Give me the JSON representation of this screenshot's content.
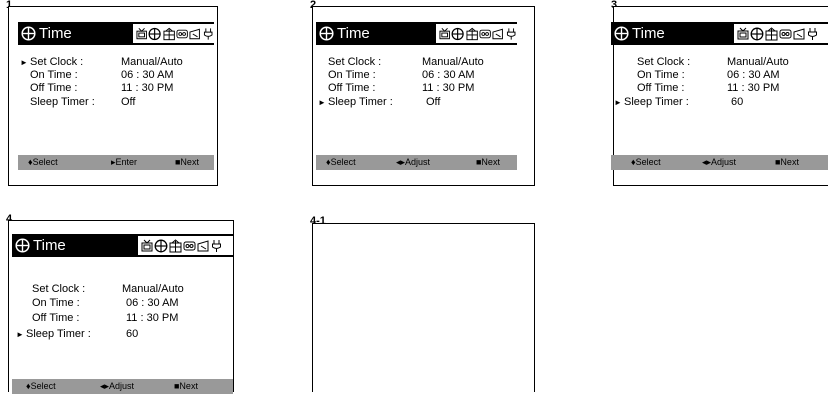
{
  "screens": [
    {
      "number": "1",
      "title": "Time",
      "labels": {
        "set_clock": "Set Clock :",
        "on_time": "On Time :",
        "off_time": "Off Time :",
        "sleep_timer": "Sleep Timer :"
      },
      "values": {
        "set_clock": "Manual/Auto",
        "on_time": "06 : 30  AM",
        "off_time": "11 : 30  PM",
        "sleep_timer": "Off"
      },
      "selected_row": "set_clock",
      "footer": {
        "left": "♦Select",
        "middle": "▸Enter",
        "right": "■Next"
      }
    },
    {
      "number": "2",
      "title": "Time",
      "labels": {
        "set_clock": "Set Clock :",
        "on_time": "On Time :",
        "off_time": "Off Time :",
        "sleep_timer": "Sleep Timer :"
      },
      "values": {
        "set_clock": "Manual/Auto",
        "on_time": "06 : 30  AM",
        "off_time": "11 : 30  PM",
        "sleep_timer": "Off"
      },
      "selected_row": "sleep_timer",
      "footer": {
        "left": "♦Select",
        "middle": "◂▸Adjust",
        "right": "■Next"
      }
    },
    {
      "number": "3",
      "title": "Time",
      "labels": {
        "set_clock": "Set Clock :",
        "on_time": "On Time :",
        "off_time": "Off Time :",
        "sleep_timer": "Sleep Timer :"
      },
      "values": {
        "set_clock": "Manual/Auto",
        "on_time": "06 : 30  AM",
        "off_time": "11 : 30  PM",
        "sleep_timer": "60"
      },
      "selected_row": "sleep_timer",
      "footer": {
        "left": "♦Select",
        "middle": "◂▸Adjust",
        "right": "■Next"
      }
    },
    {
      "number": "4",
      "title": "Time",
      "labels": {
        "set_clock": "Set Clock :",
        "on_time": "On Time :",
        "off_time": "Off Time :",
        "sleep_timer": "Sleep Timer :"
      },
      "values": {
        "set_clock": "Manual/Auto",
        "on_time": "06 : 30  AM",
        "off_time": "11 : 30  PM",
        "sleep_timer": "60"
      },
      "selected_row": "sleep_timer",
      "footer": {
        "left": "♦Select",
        "middle": "◂▸Adjust",
        "right": "■Next"
      }
    }
  ],
  "blank_step": {
    "number": "4-1"
  },
  "menu_icons": [
    "tv-antenna-icon",
    "time-icon",
    "gift-icon",
    "tape-icon",
    "box-icon",
    "plug-icon"
  ],
  "colors": {
    "title_bar": "#000000",
    "footer_bar": "#999999"
  }
}
